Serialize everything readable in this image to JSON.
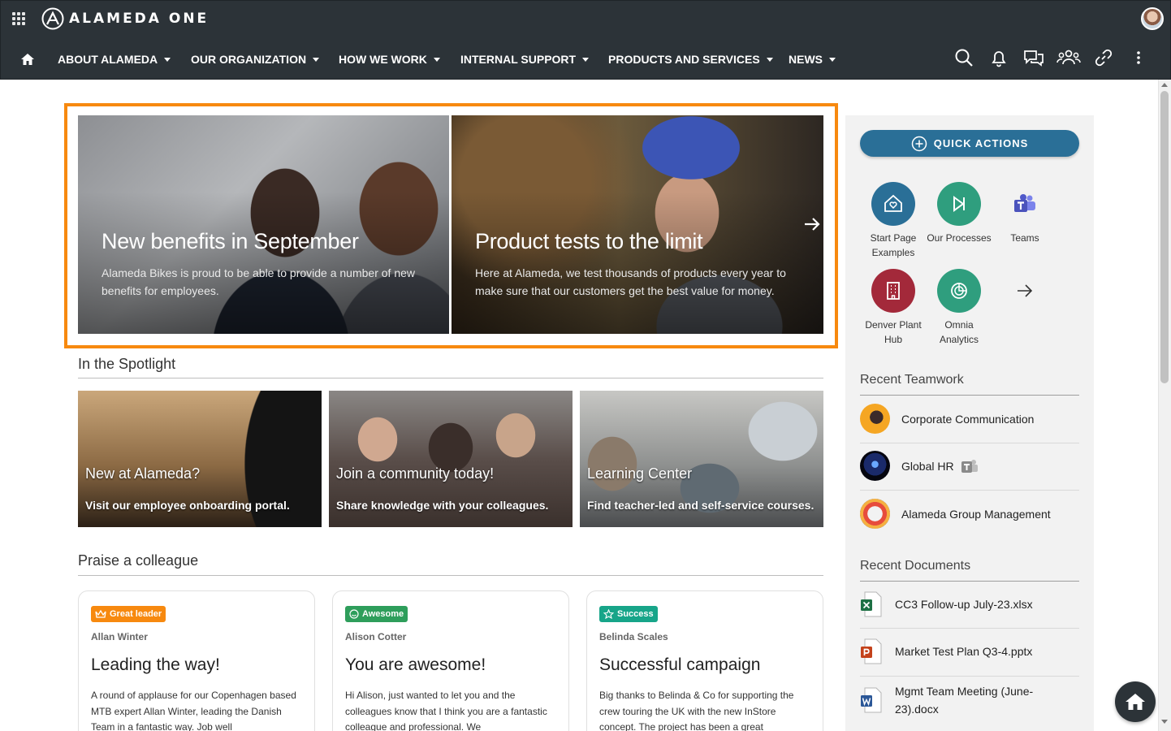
{
  "app": {
    "brand": "ALAMEDA ONE"
  },
  "nav": {
    "items": [
      {
        "label": "ABOUT ALAMEDA"
      },
      {
        "label": "OUR ORGANIZATION"
      },
      {
        "label": "HOW WE WORK"
      },
      {
        "label": "INTERNAL SUPPORT"
      },
      {
        "label": "PRODUCTS AND SERVICES"
      },
      {
        "label": "NEWS"
      }
    ],
    "icons": [
      "search-icon",
      "bell-icon",
      "chat-icon",
      "people-icon",
      "link-icon",
      "more-vertical-icon"
    ]
  },
  "hero": {
    "slides": [
      {
        "title": "New benefits in September",
        "text": "Alameda Bikes is proud to be able to provide a number of new benefits for employees."
      },
      {
        "title": "Product tests to the limit",
        "text": "Here at Alameda, we test thousands of products every year to make sure that our customers get the best value for money."
      }
    ],
    "highlight_color": "#f7890f"
  },
  "spotlight": {
    "title": "In the Spotlight",
    "cards": [
      {
        "title": "New at Alameda?",
        "subtitle": "Visit our employee onboarding portal."
      },
      {
        "title": "Join a community today!",
        "subtitle": "Share knowledge with your colleagues."
      },
      {
        "title": "Learning Center",
        "subtitle": "Find teacher-led and self-service courses."
      }
    ]
  },
  "praise": {
    "title": "Praise a colleague",
    "cards": [
      {
        "badge": "Great leader",
        "badge_color": "#f7890f",
        "badge_icon": "crown-icon",
        "person": "Allan Winter",
        "title": "Leading the way!",
        "body": "A round of applause for our Copenhagen based MTB expert Allan Winter, leading the Danish Team in a fantastic way. Job well"
      },
      {
        "badge": "Awesome",
        "badge_color": "#2e9e5b",
        "badge_icon": "smile-icon",
        "person": "Alison Cotter",
        "title": "You are awesome!",
        "body": "Hi Alison, just wanted to let you and the colleagues know that I think you are a fantastic colleague and professional. We"
      },
      {
        "badge": "Success",
        "badge_color": "#17a589",
        "badge_icon": "star-icon",
        "person": "Belinda Scales",
        "title": "Successful campaign",
        "body": "Big thanks to Belinda & Co for supporting the crew touring the UK with the new InStore concept. The project has been a great"
      }
    ]
  },
  "quick_actions": {
    "button_label": "QUICK ACTIONS",
    "items": [
      {
        "label": "Start Page Examples",
        "color": "#2a6f97",
        "icon": "home-heart-icon"
      },
      {
        "label": "Our Processes",
        "color": "#2f9e7e",
        "icon": "play-step-icon"
      },
      {
        "label": "Teams",
        "color": "",
        "icon": "teams-icon"
      },
      {
        "label": "Denver Plant Hub",
        "color": "#a3293a",
        "icon": "building-icon"
      },
      {
        "label": "Omnia Analytics",
        "color": "#2f9e7e",
        "icon": "analytics-icon"
      }
    ]
  },
  "recent_teamwork": {
    "title": "Recent Teamwork",
    "items": [
      {
        "label": "Corporate Communication"
      },
      {
        "label": "Global HR"
      },
      {
        "label": "Alameda Group Management"
      }
    ]
  },
  "recent_documents": {
    "title": "Recent Documents",
    "items": [
      {
        "label": "CC3 Follow-up July-23.xlsx",
        "type": "excel"
      },
      {
        "label": "Market Test Plan Q3-4.pptx",
        "type": "powerpoint"
      },
      {
        "label": "Mgmt Team Meeting (June-23).docx",
        "type": "word"
      }
    ]
  }
}
